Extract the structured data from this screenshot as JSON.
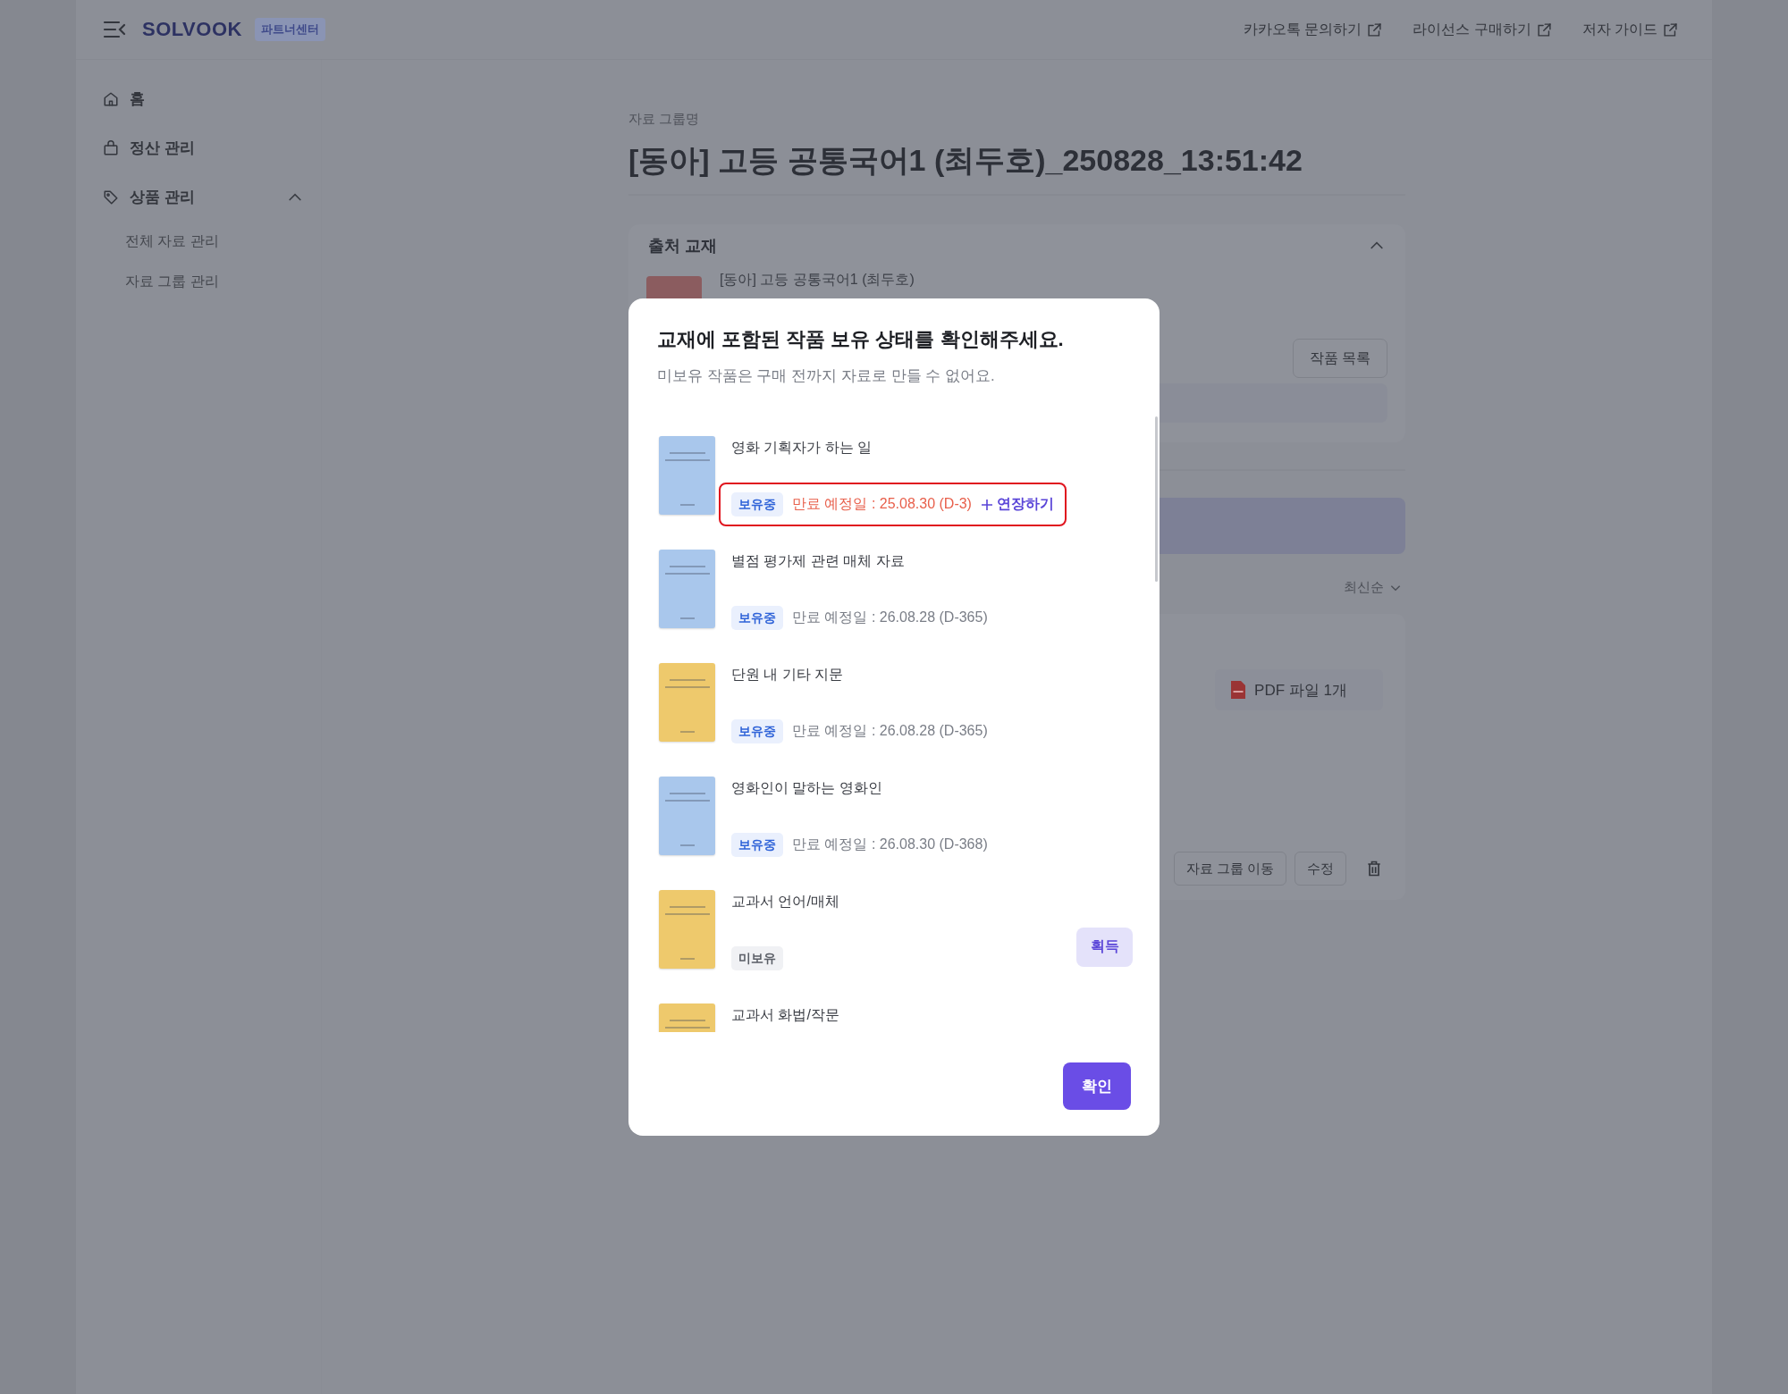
{
  "header": {
    "logo": "SOLVOOK",
    "badge": "파트너센터",
    "links": [
      {
        "label": "카카오톡 문의하기"
      },
      {
        "label": "라이선스 구매하기"
      },
      {
        "label": "저자 가이드"
      }
    ]
  },
  "sidebar": {
    "items": [
      {
        "kind": "home",
        "label": "홈"
      },
      {
        "kind": "bag",
        "label": "정산 관리"
      },
      {
        "kind": "tag",
        "label": "상품 관리",
        "expanded": true,
        "children": [
          {
            "label": "전체 자료 관리"
          },
          {
            "label": "자료 그룹 관리"
          }
        ]
      }
    ]
  },
  "page": {
    "caption": "자료 그룹명",
    "title": "[동아] 고등 공통국어1 (최두호)_250828_13:51:42"
  },
  "source_panel": {
    "title": "출처 교재",
    "expanded": true,
    "book_title": "[동아] 고등 공통국어1 (최두호)",
    "button": "작품 목록"
  },
  "materials": {
    "sort": "최신순",
    "file_chip": "PDF 파일 1개",
    "buttons": [
      "자료 그룹 이동",
      "수정"
    ]
  },
  "modal": {
    "title": "교재에 포함된 작품 보유 상태를 확인해주세요.",
    "subtitle": "미보유 작품은 구매 전까지 자료로 만들 수 없어요.",
    "items": [
      {
        "title": "영화 기획자가 하는 일",
        "color": "#a9c7ec",
        "owned": true,
        "badge": "보유중",
        "expiry": "만료 예정일 : 25.08.30 (D-3)",
        "urgent": true,
        "extend": "연장하기",
        "highlighted": true
      },
      {
        "title": "별점 평가제 관련 매체 자료",
        "color": "#a9c7ec",
        "owned": true,
        "badge": "보유중",
        "expiry": "만료 예정일 : 26.08.28 (D-365)",
        "urgent": false
      },
      {
        "title": "단원 내 기타 지문",
        "color": "#eec96c",
        "owned": true,
        "badge": "보유중",
        "expiry": "만료 예정일 : 26.08.28 (D-365)",
        "urgent": false
      },
      {
        "title": "영화인이 말하는 영화인",
        "color": "#a9c7ec",
        "owned": true,
        "badge": "보유중",
        "expiry": "만료 예정일 : 26.08.30 (D-368)",
        "urgent": false
      },
      {
        "title": "교과서 언어/매체",
        "color": "#eec96c",
        "owned": false,
        "badge": "미보유",
        "action": "획득"
      },
      {
        "title": "교과서 화법/작문",
        "color": "#eec96c"
      }
    ],
    "confirm": "확인"
  }
}
